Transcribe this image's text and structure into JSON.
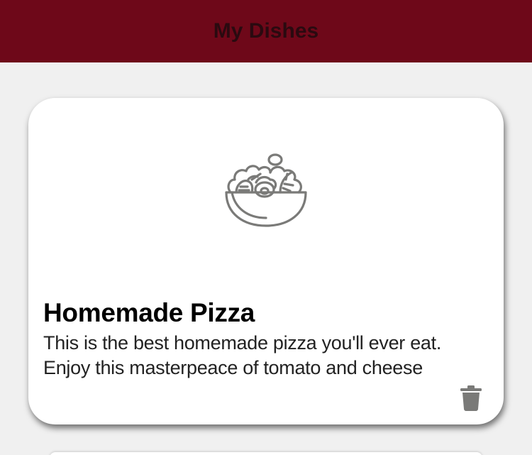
{
  "header": {
    "title": "My Dishes"
  },
  "dishes": [
    {
      "image_icon": "salad-bowl-icon",
      "name": "Homemade Pizza",
      "description": "This is the best homemade pizza you'll ever eat. Enjoy this masterpeace of tomato and cheese",
      "delete_icon": "trash-icon"
    }
  ],
  "colors": {
    "header_background": "#6e0819",
    "header_title": "#2a0a10",
    "page_background": "#f0f0f0",
    "card_background": "#ffffff",
    "icon_gray": "#7a7a78"
  }
}
